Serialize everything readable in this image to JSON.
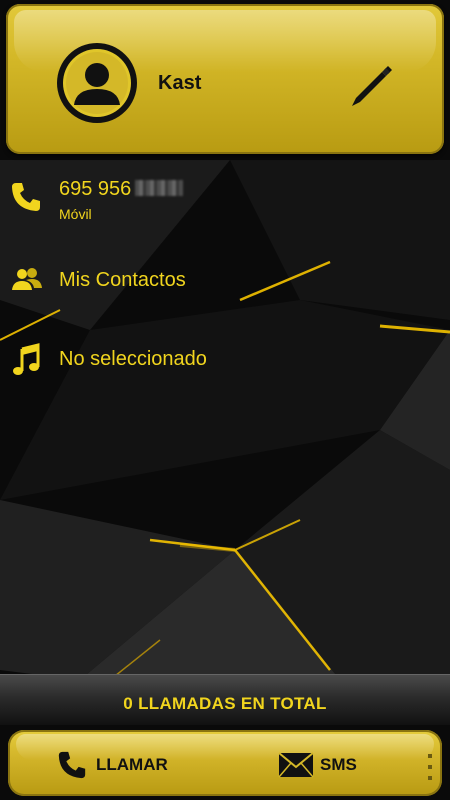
{
  "contact": {
    "name": "Kast"
  },
  "phone": {
    "number": "695 956",
    "type": "Móvil"
  },
  "group": {
    "label": "Mis Contactos"
  },
  "ringtone": {
    "label": "No seleccionado"
  },
  "stats": {
    "total_calls": "0 LLAMADAS EN TOTAL"
  },
  "actions": {
    "call_label": "LLAMAR",
    "sms_label": "SMS"
  },
  "colors": {
    "accent": "#f1d51e",
    "header_gold": "#d4b828",
    "background": "#0b0b0b"
  },
  "icons": {
    "avatar": "person-silhouette-icon",
    "edit": "pencil-icon",
    "phone": "phone-icon",
    "group": "contacts-group-icon",
    "ringtone": "music-note-icon",
    "sms": "envelope-icon",
    "overflow": "dots-icon"
  }
}
